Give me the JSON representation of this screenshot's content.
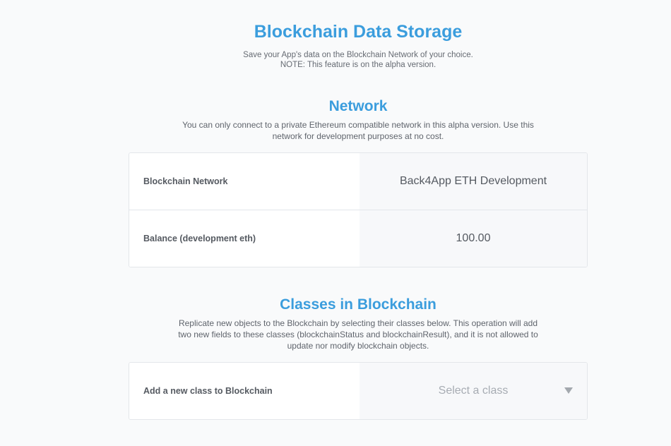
{
  "header": {
    "title": "Blockchain Data Storage",
    "subtitle_line1": "Save your App's data on the Blockchain Network of your choice.",
    "subtitle_line2": "NOTE: This feature is on the alpha version."
  },
  "network": {
    "title": "Network",
    "description": "You can only connect to a private Ethereum compatible network in this alpha version. Use this network for development purposes at no cost.",
    "rows": [
      {
        "label": "Blockchain Network",
        "value": "Back4App ETH Development"
      },
      {
        "label": "Balance (development eth)",
        "value": "100.00"
      }
    ]
  },
  "classes": {
    "title": "Classes in Blockchain",
    "description": "Replicate new objects to the Blockchain by selecting their classes below. This operation will add two new fields to these classes (blockchainStatus and blockchainResult), and it is not allowed to update nor modify blockchain objects.",
    "add_label": "Add a new class to Blockchain",
    "select_placeholder": "Select a class"
  }
}
